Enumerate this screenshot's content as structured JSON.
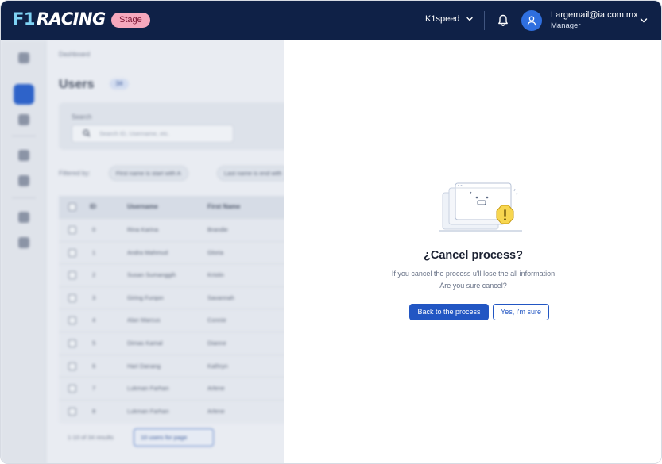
{
  "header": {
    "logo_f1": "F1",
    "logo_text": "RACING",
    "env_badge": "Stage",
    "workspace": "K1speed",
    "user_email": "Largemail@ia.com.mx",
    "user_role": "Manager"
  },
  "background": {
    "breadcrumb": "Dashboard",
    "page_title": "Users",
    "count": "34",
    "search_label": "Search",
    "search_placeholder": "Search ID, Username, etc.",
    "filtered_by": "Filtered by:",
    "chips": [
      "First name is start with A",
      "Last name is end with"
    ],
    "columns": [
      "ID",
      "Username",
      "First Name"
    ],
    "rows": [
      {
        "id": "0",
        "username": "Rina Karina",
        "first": "Brandie"
      },
      {
        "id": "1",
        "username": "Andra Mahmud",
        "first": "Gloria"
      },
      {
        "id": "2",
        "username": "Susan Sumanggih",
        "first": "Kristin"
      },
      {
        "id": "3",
        "username": "Giring Furqon",
        "first": "Savannah"
      },
      {
        "id": "4",
        "username": "Alan Marcus",
        "first": "Connie"
      },
      {
        "id": "5",
        "username": "Dimas Kamal",
        "first": "Dianne"
      },
      {
        "id": "6",
        "username": "Hari Danang",
        "first": "Kathryn"
      },
      {
        "id": "7",
        "username": "Lukman Farhan",
        "first": "Arlene"
      },
      {
        "id": "8",
        "username": "Lukman Farhan",
        "first": "Arlene"
      }
    ],
    "pager_text": "1-10 of 34 results",
    "pager_select": "10 users for page"
  },
  "dialog": {
    "title": "¿Cancel process?",
    "message_line1": "If you cancel the process u'll lose the all information",
    "message_line2": "Are you sure cancel?",
    "primary_label": "Back to the process",
    "secondary_label": "Yes, i'm sure"
  },
  "colors": {
    "topbar": "#0f2147",
    "primary": "#2256c3",
    "badge": "#f6a8bd",
    "warning": "#f7d64f"
  },
  "icons": [
    "home-icon",
    "users-icon",
    "car-icon",
    "briefcase-icon",
    "document-icon",
    "settings-icon",
    "person-icon",
    "bell-icon",
    "user-icon",
    "chevron-down-icon",
    "search-icon",
    "warning-icon"
  ]
}
